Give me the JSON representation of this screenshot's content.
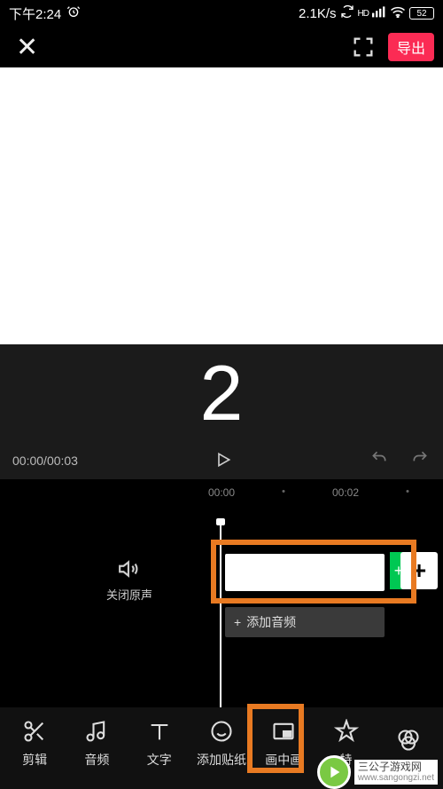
{
  "status": {
    "time": "下午2:24",
    "alarm_icon": "alarm",
    "netspeed": "2.1K/s",
    "battery": "52"
  },
  "topbar": {
    "close_label": "✕",
    "export_label": "导出"
  },
  "countdown": {
    "value": "2"
  },
  "playrow": {
    "current": "00:00",
    "total": "00:03"
  },
  "ruler": {
    "t0": "00:00",
    "t1": "00:02"
  },
  "timeline": {
    "mute_label": "关闭原声",
    "add_audio_label": "添加音频",
    "add_audio_plus": "+",
    "add_clip_label": "+"
  },
  "toolbar": {
    "items": [
      {
        "key": "edit",
        "label": "剪辑"
      },
      {
        "key": "audio",
        "label": "音频"
      },
      {
        "key": "text",
        "label": "文字"
      },
      {
        "key": "sticker",
        "label": "添加贴纸"
      },
      {
        "key": "pip",
        "label": "画中画"
      },
      {
        "key": "effect",
        "label": "特"
      },
      {
        "key": "filter",
        "label": ""
      }
    ]
  },
  "watermark": {
    "line1": "三公子游戏网",
    "line2": "www.sangongzi.net"
  }
}
